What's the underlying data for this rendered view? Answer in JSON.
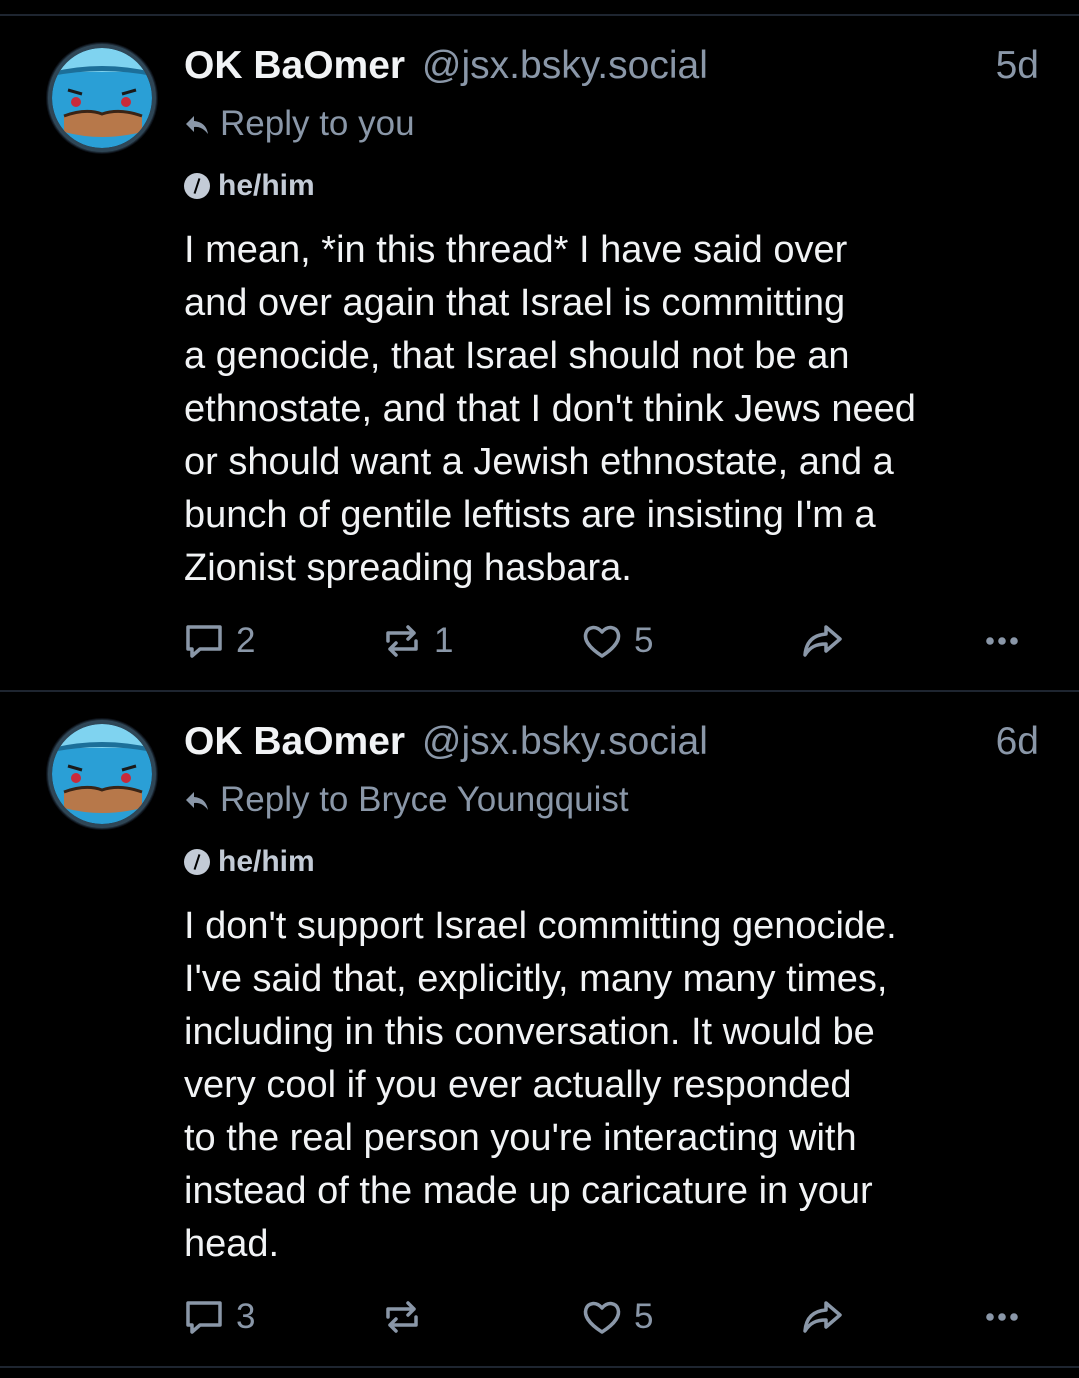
{
  "posts": [
    {
      "author_name": "OK BaOmer",
      "author_handle": "@jsx.bsky.social",
      "time": "5d",
      "reply_label": "Reply to you",
      "pronouns": "he/him",
      "text": [
        "I mean, *in this thread* I have said over",
        "and over again that Israel is committing",
        "a genocide, that Israel should not be an",
        "ethnostate, and that I don't think Jews need",
        "or should want a Jewish ethnostate, and a",
        "bunch of gentile leftists are insisting I'm a",
        "Zionist spreading hasbara."
      ],
      "reply_count": "2",
      "repost_count": "1",
      "like_count": "5"
    },
    {
      "author_name": "OK BaOmer",
      "author_handle": "@jsx.bsky.social",
      "time": "6d",
      "reply_label": "Reply to Bryce Youngquist",
      "pronouns": "he/him",
      "text": [
        "I don't support Israel committing genocide.",
        "I've said that, explicitly, many many times,",
        "including in this conversation. It would be",
        "very cool if you ever actually responded",
        "to the real person you're interacting with",
        "instead of the made up caricature in your",
        "head."
      ],
      "reply_count": "3",
      "repost_count": "",
      "like_count": "5"
    }
  ],
  "icons": {
    "reply": "speech-bubble-icon",
    "repost": "repost-arrows-icon",
    "like": "heart-outline-icon",
    "share": "share-arrow-icon",
    "more": "ellipsis-icon",
    "reply_indicator": "reply-arrow-icon",
    "pronoun_badge": "pronoun-badge-icon"
  },
  "colors": {
    "background": "#000000",
    "text": "#f1f3f5",
    "muted": "#8a97a8",
    "divider": "#1e2530"
  }
}
